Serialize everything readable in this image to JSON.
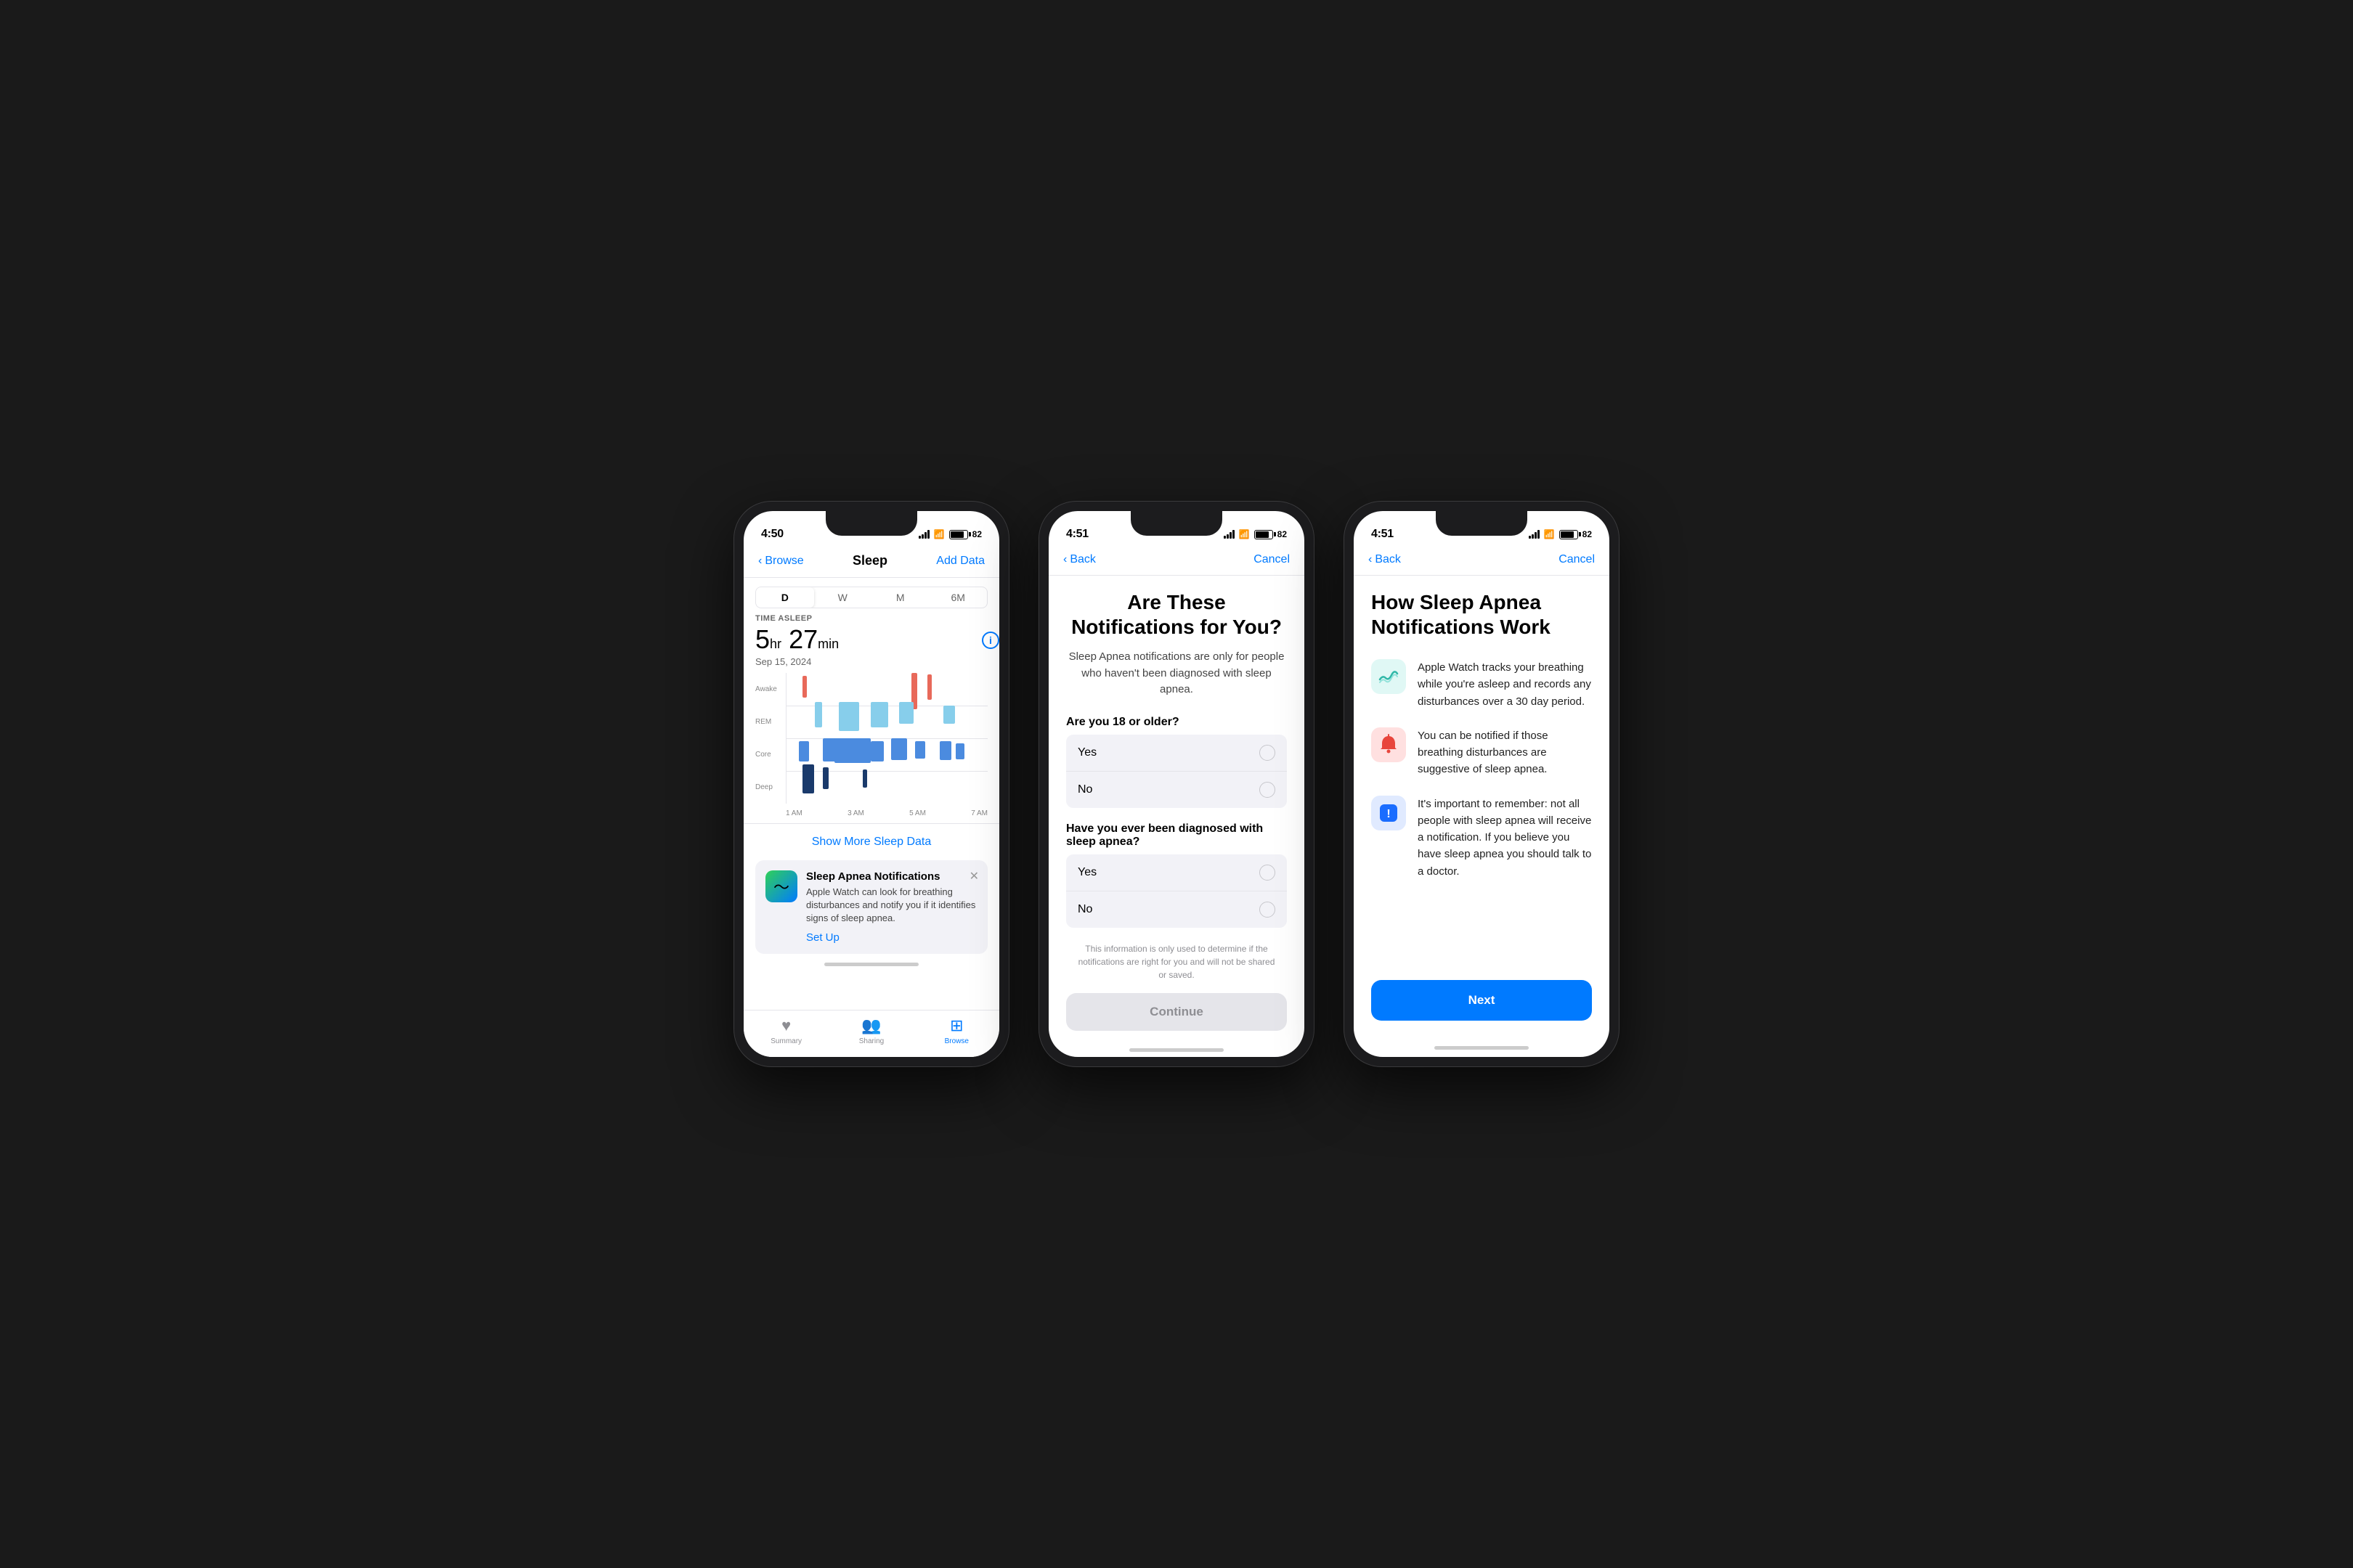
{
  "phone1": {
    "status": {
      "time": "4:50",
      "battery": "82"
    },
    "nav": {
      "back": "Browse",
      "title": "Sleep",
      "action": "Add Data"
    },
    "tabs": [
      "D",
      "W",
      "M",
      "6M"
    ],
    "active_tab": 0,
    "sleep_label": "TIME ASLEEP",
    "sleep_hours": "5",
    "sleep_hr_unit": "hr",
    "sleep_minutes": "27",
    "sleep_min_unit": "min",
    "sleep_date": "Sep 15, 2024",
    "chart_labels": [
      "Awake",
      "REM",
      "Core",
      "Deep"
    ],
    "time_labels": [
      "1 AM",
      "3 AM",
      "5 AM",
      "7 AM"
    ],
    "show_more": "Show More Sleep Data",
    "notification": {
      "title": "Sleep Apnea Notifications",
      "desc": "Apple Watch can look for breathing disturbances and notify you if it identifies signs of sleep apnea.",
      "setup": "Set Up"
    },
    "bottom_tabs": [
      {
        "label": "Summary",
        "icon": "♥",
        "active": false
      },
      {
        "label": "Sharing",
        "icon": "👥",
        "active": false
      },
      {
        "label": "Browse",
        "icon": "⊞",
        "active": true
      }
    ]
  },
  "phone2": {
    "status": {
      "time": "4:51",
      "battery": "82"
    },
    "nav": {
      "back": "Back",
      "action": "Cancel"
    },
    "title": "Are These Notifications for You?",
    "subtitle": "Sleep Apnea notifications are only for people who haven't been diagnosed with sleep apnea.",
    "q1": "Are you 18 or older?",
    "q1_options": [
      "Yes",
      "No"
    ],
    "q2": "Have you ever been diagnosed with sleep apnea?",
    "q2_options": [
      "Yes",
      "No"
    ],
    "disclaimer": "This information is only used to determine if the notifications are right for you and will not be shared or saved.",
    "continue_btn": "Continue"
  },
  "phone3": {
    "status": {
      "time": "4:51",
      "battery": "82"
    },
    "nav": {
      "back": "Back",
      "action": "Cancel"
    },
    "title": "How Sleep Apnea Notifications Work",
    "features": [
      {
        "icon": "🌊",
        "icon_style": "teal",
        "text": "Apple Watch tracks your breathing while you're asleep and records any disturbances over a 30 day period."
      },
      {
        "icon": "🔔",
        "icon_style": "red",
        "text": "You can be notified if those breathing disturbances are suggestive of sleep apnea."
      },
      {
        "icon": "❗",
        "icon_style": "blue",
        "text": "It's important to remember: not all people with sleep apnea will receive a notification. If you believe you have sleep apnea you should talk to a doctor."
      }
    ],
    "next_btn": "Next"
  }
}
